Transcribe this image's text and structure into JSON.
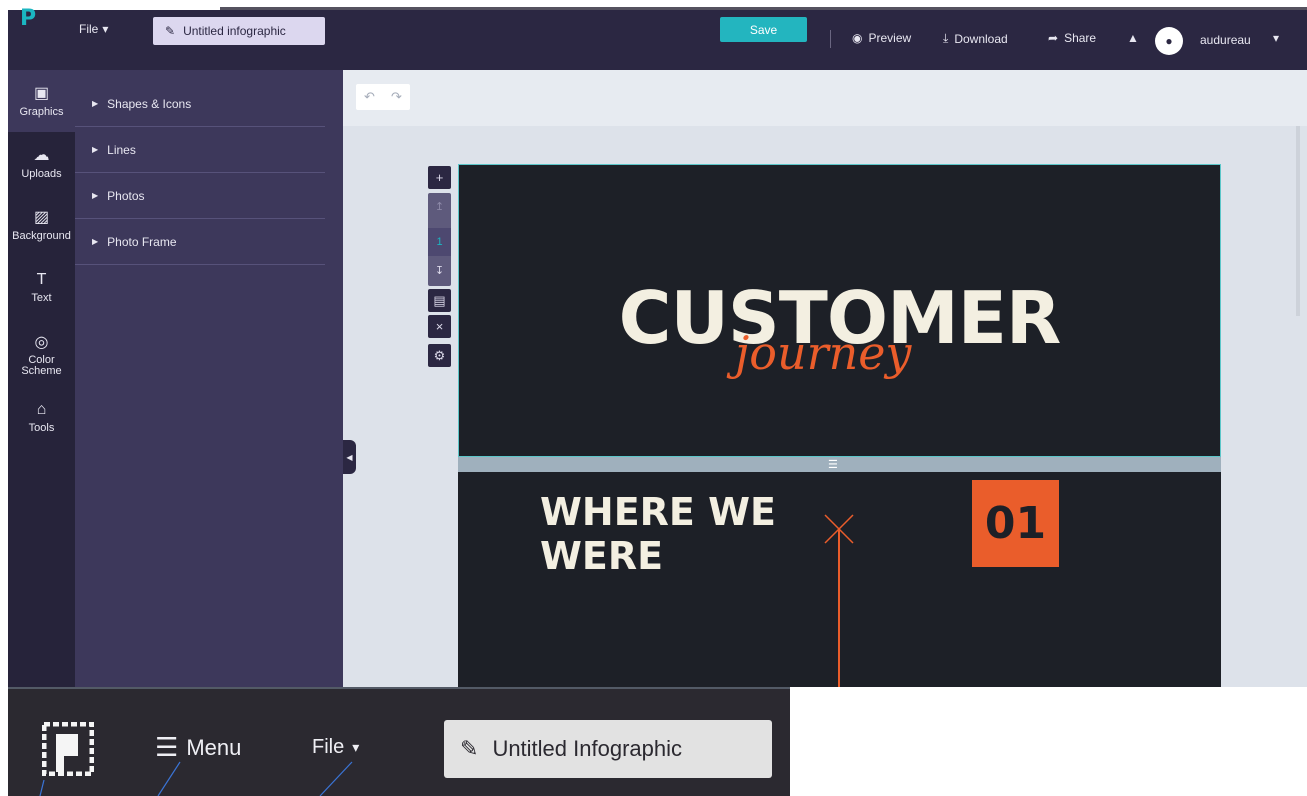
{
  "header": {
    "logo_glyph": "P",
    "file_label": "File",
    "file_chevron": "⌄",
    "doc_title": "Untitled infographic",
    "save_label": "Save",
    "preview_label": "Preview",
    "download_label": "Download",
    "share_label": "Share",
    "username": "audureau"
  },
  "rail": {
    "items": [
      {
        "label": "Graphics",
        "icon": "image-icon",
        "glyph": "▣"
      },
      {
        "label": "Uploads",
        "icon": "cloud-icon",
        "glyph": "☁"
      },
      {
        "label": "Background",
        "icon": "hatch-icon",
        "glyph": "▨"
      },
      {
        "label": "Text",
        "icon": "text-icon",
        "glyph": "T"
      },
      {
        "label": "Color Scheme",
        "icon": "palette-icon",
        "glyph": "◎"
      },
      {
        "label": "Tools",
        "icon": "toolbox-icon",
        "glyph": "⌂"
      }
    ]
  },
  "panel": {
    "rows": [
      {
        "label": "Shapes & Icons"
      },
      {
        "label": "Lines"
      },
      {
        "label": "Photos"
      },
      {
        "label": "Photo Frame"
      }
    ]
  },
  "canvas": {
    "page_number": "1",
    "headline": "CUSTOMER",
    "script_word": "journey",
    "section_title_line1": "WHERE WE",
    "section_title_line2": "WERE",
    "section_number": "01"
  },
  "inset": {
    "menu_label": "Menu",
    "file_label": "File",
    "doc_title": "Untitled Infographic"
  },
  "colors": {
    "topbar": "#2b2742",
    "accent": "#23b5bf",
    "orange": "#ea5d2b",
    "slide": "#1d2027",
    "cream": "#f3efe1"
  }
}
